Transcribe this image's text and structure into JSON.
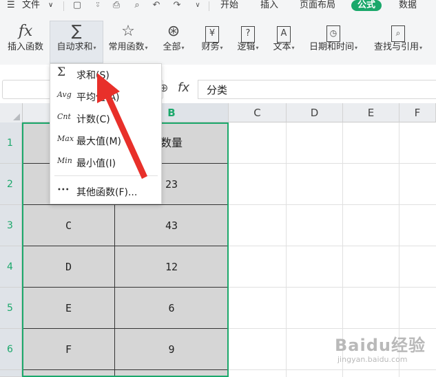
{
  "menu": {
    "file_label": "文件",
    "tabs": [
      {
        "label": "开始",
        "active": false
      },
      {
        "label": "插入",
        "active": false
      },
      {
        "label": "页面布局",
        "active": false
      },
      {
        "label": "公式",
        "active": true
      },
      {
        "label": "数据",
        "active": false
      }
    ]
  },
  "ribbon": {
    "insert_function": "插入函数",
    "autosum": "自动求和",
    "common_functions": "常用函数",
    "all": "全部",
    "finance": "财务",
    "logic": "逻辑",
    "text": "文本",
    "datetime": "日期和时间",
    "lookup": "查找与引用"
  },
  "formula_bar": {
    "name_box": "",
    "fx_label": "fx",
    "content": "分类"
  },
  "columns": [
    "B",
    "C",
    "D",
    "E",
    "F"
  ],
  "rows": [
    "1",
    "2",
    "3",
    "4",
    "5",
    "6"
  ],
  "cells": {
    "B1": "数量",
    "B2": "23",
    "A3": "C",
    "B3": "43",
    "A4": "D",
    "B4": "12",
    "A5": "E",
    "B5": "6",
    "A6": "F",
    "B6": "9"
  },
  "dropdown": {
    "items": [
      {
        "icon": "Σ",
        "label": "求和(S)"
      },
      {
        "icon": "Avg",
        "label": "平均值(A)"
      },
      {
        "icon": "Cnt",
        "label": "计数(C)"
      },
      {
        "icon": "Max",
        "label": "最大值(M)"
      },
      {
        "icon": "Min",
        "label": "最小值(I)"
      }
    ],
    "more": {
      "icon": "•••",
      "label": "其他函数(F)..."
    }
  },
  "watermark": {
    "brand": "Baidu经验",
    "url": "jingyan.baidu.com"
  },
  "colors": {
    "accent": "#1ba86b",
    "arrow": "#e8302a",
    "table_fill": "#d6d6d6"
  }
}
